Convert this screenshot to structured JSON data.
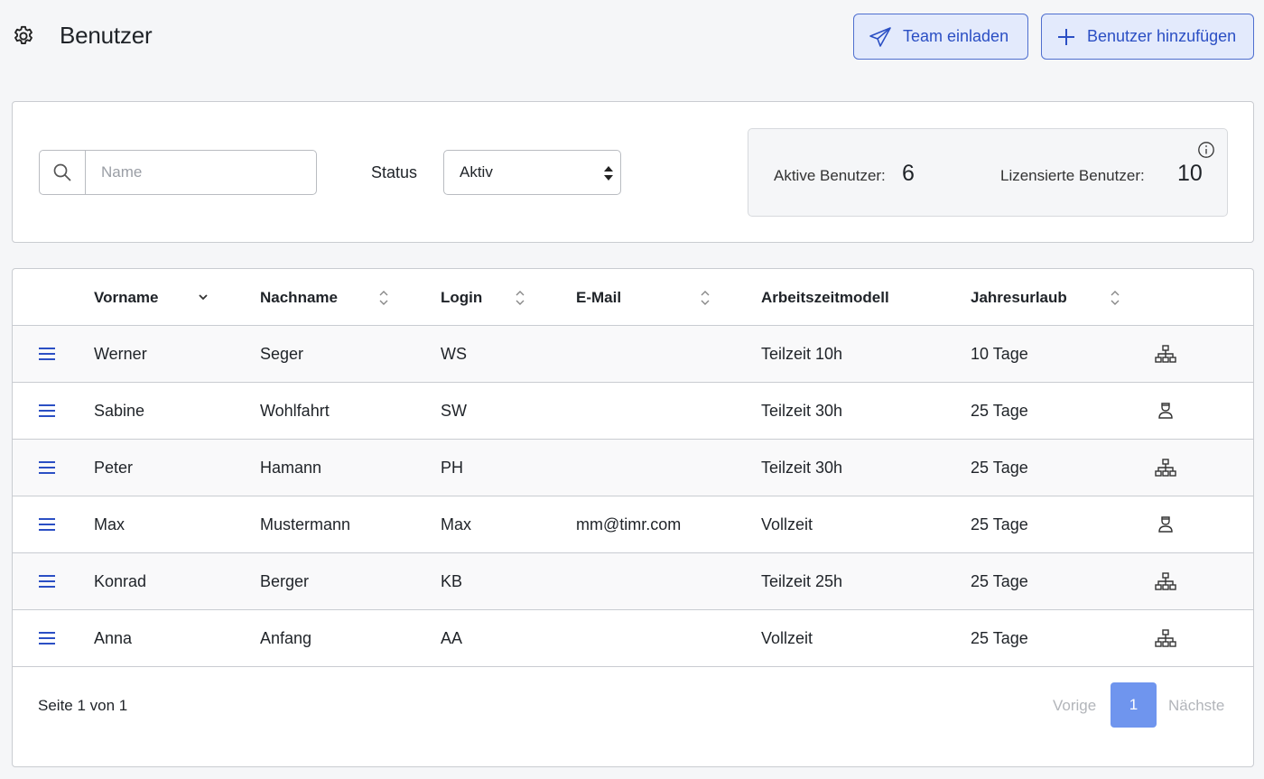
{
  "header": {
    "title": "Benutzer",
    "invite_label": "Team einladen",
    "add_label": "Benutzer hinzufügen"
  },
  "filters": {
    "search_placeholder": "Name",
    "search_value": "",
    "status_label": "Status",
    "status_value": "Aktiv"
  },
  "stats": {
    "active_label": "Aktive Benutzer:",
    "active_value": "6",
    "licensed_label": "Lizensierte Benutzer:",
    "licensed_value": "10"
  },
  "table": {
    "columns": {
      "first_name": "Vorname",
      "last_name": "Nachname",
      "login": "Login",
      "email": "E-Mail",
      "work_model": "Arbeitszeitmodell",
      "vacation": "Jahresurlaub"
    },
    "rows": [
      {
        "first_name": "Werner",
        "last_name": "Seger",
        "login": "WS",
        "email": "",
        "work_model": "Teilzeit 10h",
        "vacation": "10 Tage",
        "icon": "org-chart-icon"
      },
      {
        "first_name": "Sabine",
        "last_name": "Wohlfahrt",
        "login": "SW",
        "email": "",
        "work_model": "Teilzeit 30h",
        "vacation": "25 Tage",
        "icon": "user-icon"
      },
      {
        "first_name": "Peter",
        "last_name": "Hamann",
        "login": "PH",
        "email": "",
        "work_model": "Teilzeit 30h",
        "vacation": "25 Tage",
        "icon": "org-chart-icon"
      },
      {
        "first_name": "Max",
        "last_name": "Mustermann",
        "login": "Max",
        "email": "mm@timr.com",
        "work_model": "Vollzeit",
        "vacation": "25 Tage",
        "icon": "user-icon"
      },
      {
        "first_name": "Konrad",
        "last_name": "Berger",
        "login": "KB",
        "email": "",
        "work_model": "Teilzeit 25h",
        "vacation": "25 Tage",
        "icon": "org-chart-icon"
      },
      {
        "first_name": "Anna",
        "last_name": "Anfang",
        "login": "AA",
        "email": "",
        "work_model": "Vollzeit",
        "vacation": "25 Tage",
        "icon": "org-chart-icon"
      }
    ]
  },
  "pagination": {
    "summary": "Seite 1 von 1",
    "prev_label": "Vorige",
    "current_page": "1",
    "next_label": "Nächste"
  },
  "colors": {
    "accent": "#2b4fc4",
    "button_bg": "#e3eafc",
    "page_active": "#6f95ee"
  }
}
